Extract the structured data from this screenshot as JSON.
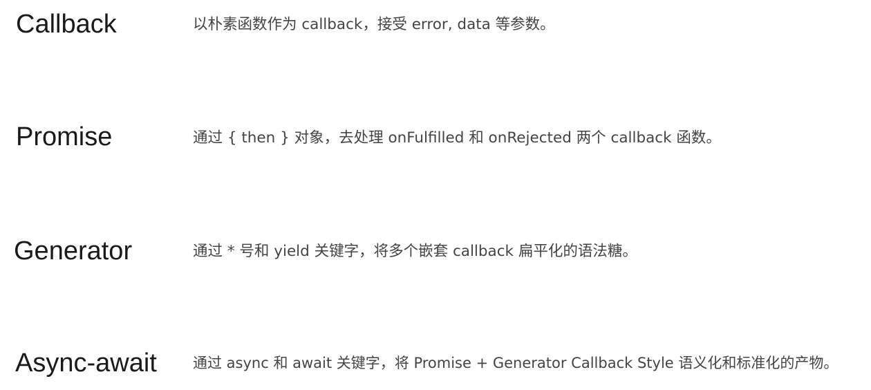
{
  "items": [
    {
      "term": "Callback",
      "description": "以朴素函数作为 callback，接受 error, data 等参数。"
    },
    {
      "term": "Promise",
      "description": "通过 { then } 对象，去处理 onFulfilled 和 onRejected 两个 callback 函数。"
    },
    {
      "term": "Generator",
      "description": "通过 * 号和 yield 关键字，将多个嵌套 callback 扁平化的语法糖。"
    },
    {
      "term": "Async-await",
      "description": "通过 async 和 await 关键字，将 Promise  + Generator Callback Style 语义化和标准化的产物。"
    }
  ]
}
